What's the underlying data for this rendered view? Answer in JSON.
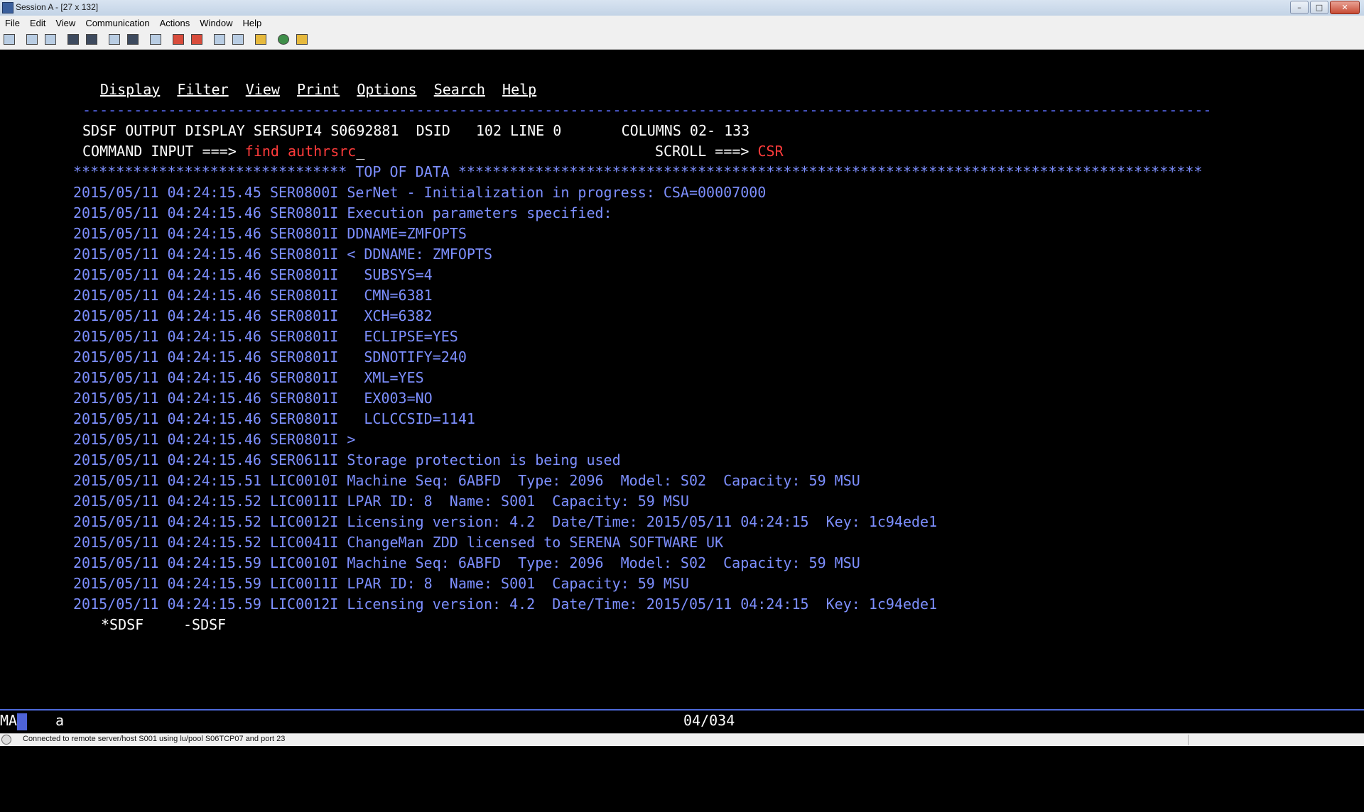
{
  "window": {
    "title": "Session A - [27 x 132]",
    "buttons": [
      "–",
      "□",
      "✕"
    ]
  },
  "menubar": [
    "File",
    "Edit",
    "View",
    "Communication",
    "Actions",
    "Window",
    "Help"
  ],
  "toolbar": {
    "icons": [
      "print-screen-icon",
      "copy-icon",
      "paste-icon",
      "send-icon",
      "receive-icon",
      "display-icon",
      "keypad-icon",
      "record-icon",
      "macro-play-icon",
      "macro-stop-icon",
      "transfer-send-icon",
      "transfer-receive-icon",
      "clipboard-icon",
      "globe-icon",
      "help-icon"
    ]
  },
  "terminal": {
    "action_bar": [
      "Display",
      "Filter",
      "View",
      "Print",
      "Options",
      "Search",
      "Help"
    ],
    "separator": "------------------------------------------------------------------------------------------------------------------------------------",
    "header": "SDSF OUTPUT DISPLAY SERSUPI4 S0692881  DSID   102 LINE 0       COLUMNS 02- 133",
    "command_label": "COMMAND INPUT ===> ",
    "command_value": "find authrsrc",
    "scroll_label": "SCROLL ===> ",
    "scroll_value": "CSR",
    "top_of_data": "******************************** TOP OF DATA ***************************************************************************************",
    "lines": [
      "2015/05/11 04:24:15.45 SER0800I SerNet - Initialization in progress: CSA=00007000",
      "2015/05/11 04:24:15.46 SER0801I Execution parameters specified:",
      "2015/05/11 04:24:15.46 SER0801I DDNAME=ZMFOPTS",
      "2015/05/11 04:24:15.46 SER0801I < DDNAME: ZMFOPTS",
      "2015/05/11 04:24:15.46 SER0801I   SUBSYS=4",
      "2015/05/11 04:24:15.46 SER0801I   CMN=6381",
      "2015/05/11 04:24:15.46 SER0801I   XCH=6382",
      "2015/05/11 04:24:15.46 SER0801I   ECLIPSE=YES",
      "2015/05/11 04:24:15.46 SER0801I   SDNOTIFY=240",
      "2015/05/11 04:24:15.46 SER0801I   XML=YES",
      "2015/05/11 04:24:15.46 SER0801I   EX003=NO",
      "2015/05/11 04:24:15.46 SER0801I   LCLCCSID=1141",
      "2015/05/11 04:24:15.46 SER0801I >",
      "2015/05/11 04:24:15.46 SER0611I Storage protection is being used",
      "2015/05/11 04:24:15.51 LIC0010I Machine Seq: 6ABFD  Type: 2096  Model: S02  Capacity: 59 MSU",
      "2015/05/11 04:24:15.52 LIC0011I LPAR ID: 8  Name: S001  Capacity: 59 MSU",
      "2015/05/11 04:24:15.52 LIC0012I Licensing version: 4.2  Date/Time: 2015/05/11 04:24:15  Key: 1c94ede1",
      "2015/05/11 04:24:15.52 LIC0041I ChangeMan ZDD licensed to SERENA SOFTWARE UK",
      "2015/05/11 04:24:15.59 LIC0010I Machine Seq: 6ABFD  Type: 2096  Model: S02  Capacity: 59 MSU",
      "2015/05/11 04:24:15.59 LIC0011I LPAR ID: 8  Name: S001  Capacity: 59 MSU",
      "2015/05/11 04:24:15.59 LIC0012I Licensing version: 4.2  Date/Time: 2015/05/11 04:24:15  Key: 1c94ede1"
    ],
    "bottom_tabs": [
      "*SDSF",
      "-SDSF"
    ]
  },
  "oia": {
    "indicator": "MA",
    "field": "a",
    "cursor_position": "04/034"
  },
  "statusbar": {
    "text": "Connected to remote server/host S001 using lu/pool S06TCP07 and port 23"
  },
  "colors": {
    "terminal_bg": "#000000",
    "text_blue": "#7d8fff",
    "text_white": "#ffffff",
    "text_red": "#ff3b3b"
  }
}
